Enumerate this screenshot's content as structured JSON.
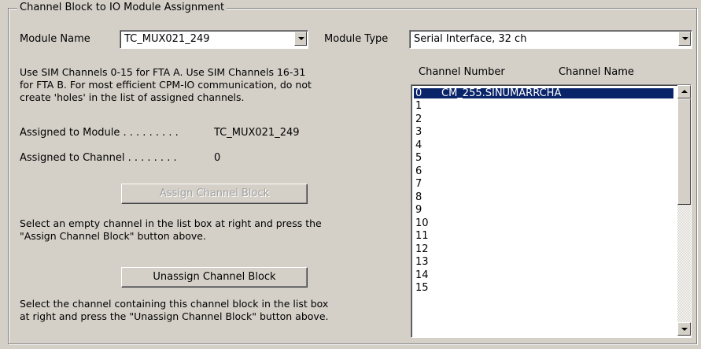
{
  "group": {
    "title": "Channel Block to IO Module Assignment"
  },
  "module_name": {
    "label": "Module Name",
    "value": "TC_MUX021_249"
  },
  "module_type": {
    "label": "Module Type",
    "value": "Serial Interface, 32 ch"
  },
  "info": {
    "line1": "Use SIM Channels 0-15 for FTA A.  Use SIM Channels 16-31",
    "line2": "for FTA B.  For most efficient CPM-IO communication, do not",
    "line3": "create 'holes' in the list of assigned channels."
  },
  "assigned_module": {
    "label": "Assigned to Module . . . . . . . . .",
    "value": "TC_MUX021_249"
  },
  "assigned_channel": {
    "label": "Assigned to Channel . . . . . . . .",
    "value": "0"
  },
  "assign_button": {
    "label": "Assign Channel Block"
  },
  "assign_help": {
    "line1": "Select an empty channel in the list box at right and press the",
    "line2": "\"Assign Channel Block\" button above."
  },
  "unassign_button": {
    "label": "Unassign Channel Block"
  },
  "unassign_help": {
    "line1": "Select the channel containing this channel block in the list box",
    "line2": "at right and press the \"Unassign Channel Block\" button above."
  },
  "list": {
    "col_number": "Channel Number",
    "col_name": "Channel Name",
    "rows": [
      {
        "number": "0",
        "name": "CM_255.SINUMARRCHA"
      },
      {
        "number": "1",
        "name": ""
      },
      {
        "number": "2",
        "name": ""
      },
      {
        "number": "3",
        "name": ""
      },
      {
        "number": "4",
        "name": ""
      },
      {
        "number": "5",
        "name": ""
      },
      {
        "number": "6",
        "name": ""
      },
      {
        "number": "7",
        "name": ""
      },
      {
        "number": "8",
        "name": ""
      },
      {
        "number": "9",
        "name": ""
      },
      {
        "number": "10",
        "name": ""
      },
      {
        "number": "11",
        "name": ""
      },
      {
        "number": "12",
        "name": ""
      },
      {
        "number": "13",
        "name": ""
      },
      {
        "number": "14",
        "name": ""
      },
      {
        "number": "15",
        "name": ""
      }
    ]
  }
}
